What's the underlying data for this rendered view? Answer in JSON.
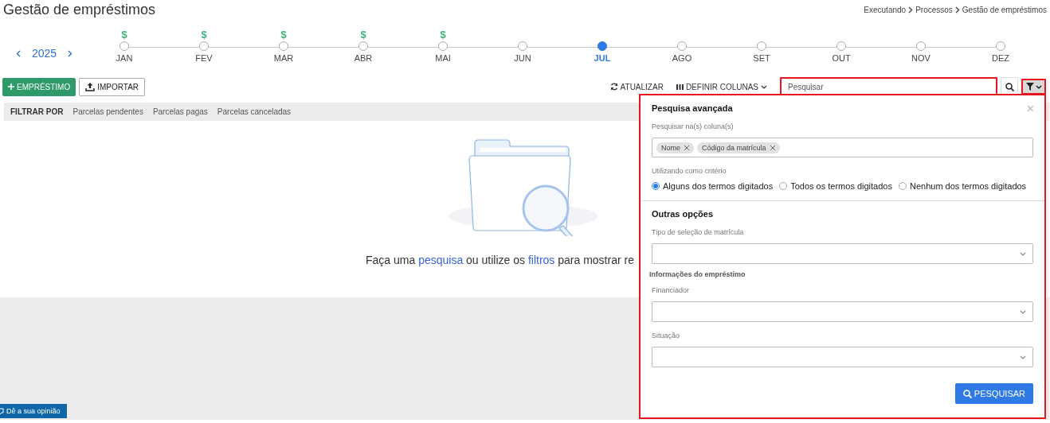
{
  "page_title": "Gestão de empréstimos",
  "breadcrumb": [
    "Executando",
    "Processos",
    "Gestão de empréstimos"
  ],
  "year": "2025",
  "months": [
    {
      "label": "JAN",
      "marker": "$",
      "selected": false
    },
    {
      "label": "FEV",
      "marker": "$",
      "selected": false
    },
    {
      "label": "MAR",
      "marker": "$",
      "selected": false
    },
    {
      "label": "ABR",
      "marker": "$",
      "selected": false
    },
    {
      "label": "MAI",
      "marker": "$",
      "selected": false
    },
    {
      "label": "JUN",
      "selected": false
    },
    {
      "label": "JUL",
      "selected": true
    },
    {
      "label": "AGO",
      "selected": false
    },
    {
      "label": "SET",
      "selected": false
    },
    {
      "label": "OUT",
      "selected": false
    },
    {
      "label": "NOV",
      "selected": false
    },
    {
      "label": "DEZ",
      "selected": false
    }
  ],
  "toolbar": {
    "new_button": "EMPRÉSTIMO",
    "import_button": "IMPORTAR",
    "refresh_button": "ATUALIZAR",
    "columns_button": "DEFINIR COLUNAS",
    "search": {
      "placeholder": "Pesquisar"
    }
  },
  "filter_bar": {
    "label": "FILTRAR POR",
    "options": [
      "Parcelas pendentes",
      "Parcelas pagas",
      "Parcelas canceladas"
    ]
  },
  "empty_state": {
    "segments": [
      {
        "kind": "text",
        "text": "Faça uma "
      },
      {
        "kind": "link",
        "text": "pesquisa"
      },
      {
        "kind": "text",
        "text": " ou utilize os "
      },
      {
        "kind": "link",
        "text": "filtros"
      },
      {
        "kind": "text",
        "text": " para mostrar re"
      }
    ]
  },
  "advanced_search": {
    "title": "Pesquisa avançada",
    "columns_label": "Pesquisar na(s) coluna(s)",
    "column_tags": [
      "Nome",
      "Código da matrícula"
    ],
    "criteria_label": "Utilizando como critério",
    "criteria": [
      {
        "label": "Alguns dos termos digitados",
        "selected": true
      },
      {
        "label": "Todos os termos digitados",
        "selected": false
      },
      {
        "label": "Nenhum dos termos digitados",
        "selected": false
      }
    ],
    "other_title": "Outras opções",
    "fields": [
      {
        "kind": "select",
        "label": "Tipo de seleção de matrícula"
      },
      {
        "kind": "heading",
        "label": "Informações do empréstimo"
      },
      {
        "kind": "select",
        "label": "Financiador"
      },
      {
        "kind": "select",
        "label": "Situação"
      }
    ],
    "submit": "PESQUISAR"
  },
  "feedback_tab": "Dê a sua opinião"
}
